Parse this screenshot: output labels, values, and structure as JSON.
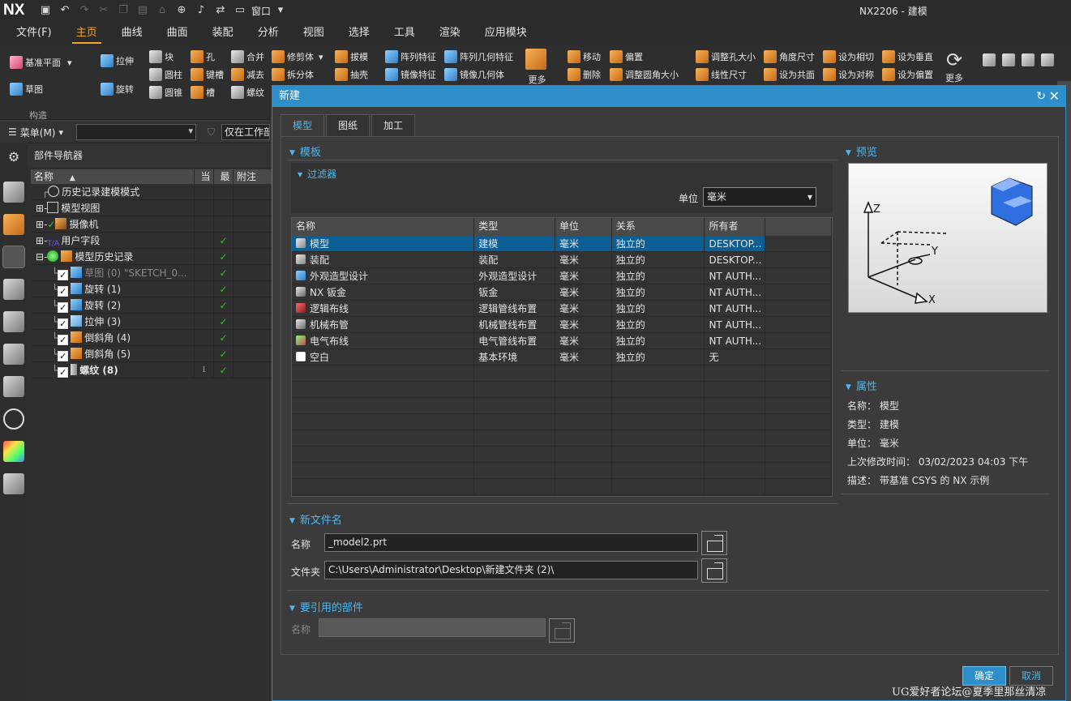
{
  "app": {
    "logo": "NX",
    "window_title": "NX2206 - 建模",
    "window_menu_label": "窗口"
  },
  "menu_tabs": [
    {
      "label": "文件(F)",
      "active": false
    },
    {
      "label": "主页",
      "active": true
    },
    {
      "label": "曲线",
      "active": false
    },
    {
      "label": "曲面",
      "active": false
    },
    {
      "label": "装配",
      "active": false
    },
    {
      "label": "分析",
      "active": false
    },
    {
      "label": "视图",
      "active": false
    },
    {
      "label": "选择",
      "active": false
    },
    {
      "label": "工具",
      "active": false
    },
    {
      "label": "渲染",
      "active": false
    },
    {
      "label": "应用模块",
      "active": false
    }
  ],
  "ribbon": {
    "datum_plane": "基准平面",
    "sketch": "草图",
    "group_label": "构造",
    "extrude": "拉伸",
    "revolve": "旋转",
    "block": "块",
    "cylinder": "圆柱",
    "cone": "圆锥",
    "hole": "孔",
    "keyslot": "键槽",
    "groove": "槽",
    "unite": "合并",
    "subtract": "减去",
    "thread": "螺纹",
    "trim_body": "修剪体",
    "split_body": "拆分体",
    "draft": "拔模",
    "shell": "抽壳",
    "pattern_feature": "阵列特征",
    "mirror_feature": "镜像特征",
    "pattern_geometry": "阵列几何特征",
    "mirror_geometry": "镜像几何体",
    "more1": "更多",
    "move": "移动",
    "delete": "删除",
    "offset": "偏置",
    "resize_blend": "调整圆角大小",
    "resize_hole": "调整孔大小",
    "linear_dim": "线性尺寸",
    "angle_dim": "角度尺寸",
    "make_coplanar": "设为共面",
    "make_tangent": "设为相切",
    "make_symmetric": "设为对称",
    "make_perpendicular": "设为垂直",
    "make_offset": "设为偏置",
    "more2": "更多"
  },
  "menu_row": {
    "menu_label": "菜单(M)",
    "scope_text": "仅在工作部件内"
  },
  "navigator": {
    "title": "部件导航器",
    "columns": [
      "名称",
      "当",
      "最",
      "附注"
    ],
    "rows": [
      {
        "name": "历史记录建模模式",
        "new": ""
      },
      {
        "name": "模型视图",
        "new": ""
      },
      {
        "name": "摄像机",
        "new": ""
      },
      {
        "name": "用户字段",
        "new": "✓"
      },
      {
        "name": "模型历史记录",
        "new": "✓"
      },
      {
        "name": "草图 (0) \"SKETCH_0...",
        "new": "✓"
      },
      {
        "name": "旋转 (1)",
        "new": "✓"
      },
      {
        "name": "旋转 (2)",
        "new": "✓"
      },
      {
        "name": "拉伸 (3)",
        "new": "✓"
      },
      {
        "name": "倒斜角 (4)",
        "new": "✓"
      },
      {
        "name": "倒斜角 (5)",
        "new": "✓"
      },
      {
        "name": "螺纹 (8)",
        "new": "✓"
      }
    ]
  },
  "dialog": {
    "title": "新建",
    "tabs": [
      "模型",
      "图纸",
      "加工"
    ],
    "template_section": "模板",
    "filter_section": "过滤器",
    "unit_label": "单位",
    "unit_value": "毫米",
    "table_columns": [
      "名称",
      "类型",
      "单位",
      "关系",
      "所有者"
    ],
    "templates": [
      {
        "name": "模型",
        "type": "建模",
        "unit": "毫米",
        "relation": "独立的",
        "owner": "DESKTOP...",
        "selected": true
      },
      {
        "name": "装配",
        "type": "装配",
        "unit": "毫米",
        "relation": "独立的",
        "owner": "DESKTOP...",
        "selected": false
      },
      {
        "name": "外观造型设计",
        "type": "外观造型设计",
        "unit": "毫米",
        "relation": "独立的",
        "owner": "NT AUTH...",
        "selected": false
      },
      {
        "name": "NX 钣金",
        "type": "钣金",
        "unit": "毫米",
        "relation": "独立的",
        "owner": "NT AUTH...",
        "selected": false
      },
      {
        "name": "逻辑布线",
        "type": "逻辑管线布置",
        "unit": "毫米",
        "relation": "独立的",
        "owner": "NT AUTH...",
        "selected": false
      },
      {
        "name": "机械布管",
        "type": "机械管线布置",
        "unit": "毫米",
        "relation": "独立的",
        "owner": "NT AUTH...",
        "selected": false
      },
      {
        "name": "电气布线",
        "type": "电气管线布置",
        "unit": "毫米",
        "relation": "独立的",
        "owner": "NT AUTH...",
        "selected": false
      },
      {
        "name": "空白",
        "type": "基本环境",
        "unit": "毫米",
        "relation": "独立的",
        "owner": "无",
        "selected": false
      }
    ],
    "preview_section": "预览",
    "properties_section": "属性",
    "properties": [
      {
        "label": "名称：",
        "value": "模型"
      },
      {
        "label": "类型：",
        "value": "建模"
      },
      {
        "label": "单位：",
        "value": "毫米"
      },
      {
        "label": "上次修改时间：",
        "value": "03/02/2023 04:03 下午"
      },
      {
        "label": "描述：",
        "value": "带基准 CSYS 的 NX 示例"
      }
    ],
    "new_file_section": "新文件名",
    "name_label": "名称",
    "name_value": "_model2.prt",
    "folder_label": "文件夹",
    "folder_value": "C:\\Users\\Administrator\\Desktop\\新建文件夹 (2)\\",
    "ref_section": "要引用的部件",
    "ref_name_label": "名称",
    "ok_label": "确定",
    "cancel_label": "取消"
  },
  "preview_axes": {
    "z": "Z",
    "y": "Y",
    "x": "X"
  },
  "watermark": "UG爱好者论坛@夏季里那丝清凉",
  "colors": {
    "accent": "#2d8ec9",
    "tab_active": "#f4a623",
    "check": "#22d022",
    "selected_row": "#0c5f95"
  }
}
